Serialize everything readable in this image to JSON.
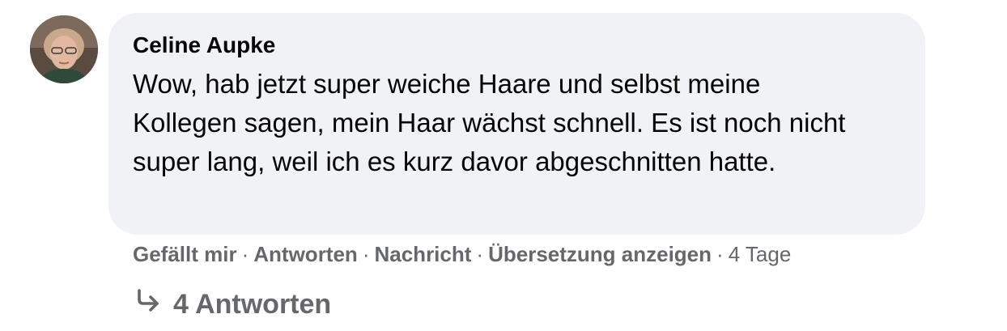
{
  "comment": {
    "author": "Celine Aupke",
    "text": "Wow, hab jetzt super weiche Haare und selbst meine Kollegen sagen, mein Haar wächst schnell. Es ist noch nicht super lang, weil ich es kurz davor abgeschnitten hatte.",
    "avatar_icon": "profile-photo"
  },
  "actions": {
    "like": "Gefällt mir",
    "reply": "Antworten",
    "message": "Nachricht",
    "translate": "Übersetzung anzeigen",
    "time": "4 Tage",
    "separator": "·"
  },
  "replies": {
    "label": "4 Antworten",
    "icon": "reply-arrow-icon"
  },
  "colors": {
    "bubble_bg": "#f0f2f5",
    "text": "#050505",
    "secondary": "#65676b"
  }
}
